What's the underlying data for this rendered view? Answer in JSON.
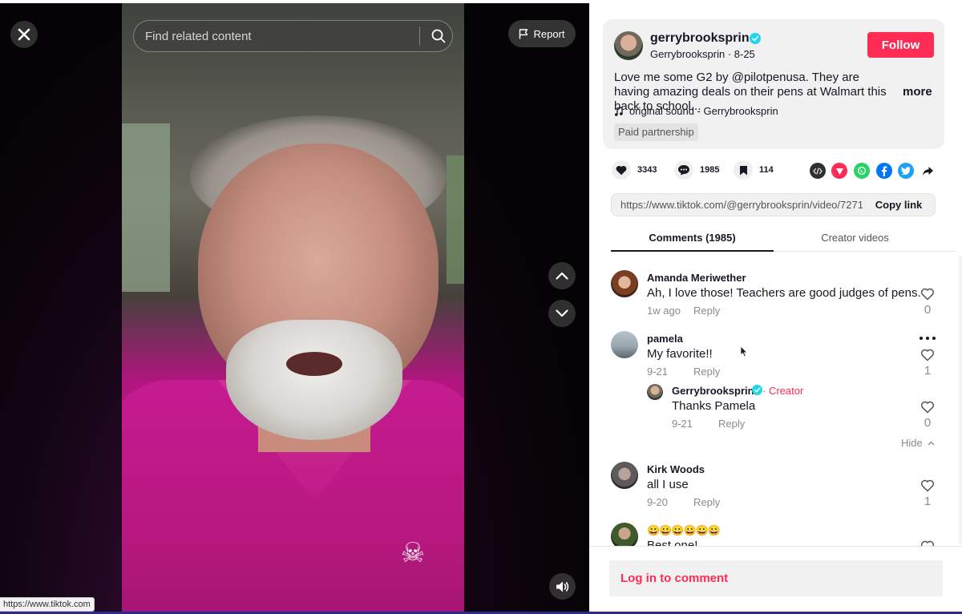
{
  "video": {
    "search_placeholder": "Find related content",
    "report_label": "Report",
    "status_url": "https://www.tiktok.com"
  },
  "author": {
    "username": "gerrybrooksprin",
    "nickname": "Gerrybrooksprin",
    "date": "8-25",
    "follow_label": "Follow",
    "caption": "Love me some G2 by @pilotpenusa. They are having amazing deals on their pens at Walmart this back to school...",
    "more_label": "more",
    "sound": "original sound - Gerrybrooksprin",
    "paid_label": "Paid partnership"
  },
  "stats": {
    "likes": "3343",
    "comments": "1985",
    "saves": "114"
  },
  "share": {
    "icons": [
      "embed-icon",
      "send-icon",
      "whatsapp-icon",
      "facebook-icon",
      "twitter-icon",
      "share-arrow-icon"
    ],
    "colors": {
      "embed": "#2f2f2f",
      "send": "#fe2c55",
      "whatsapp": "#25d366",
      "facebook": "#0075fa",
      "twitter": "#1da1f2"
    }
  },
  "link": {
    "url": "https://www.tiktok.com/@gerrybrooksprin/video/7271...",
    "copy_label": "Copy link"
  },
  "tabs": {
    "comments": "Comments (1985)",
    "creator": "Creator videos"
  },
  "comments": [
    {
      "user": "Amanda Meriwether",
      "text": "Ah, I love those! Teachers are good judges of pens.",
      "time": "1w ago",
      "reply": "Reply",
      "likes": "0"
    },
    {
      "user": "pamela",
      "text": "My favorite!!",
      "time": "9-21",
      "reply": "Reply",
      "likes": "1"
    },
    {
      "user": "Kirk Woods",
      "text": "all I use",
      "time": "9-20",
      "reply": "Reply",
      "likes": "1"
    },
    {
      "user": "😀😀😀😀😀😀",
      "text": "Best one!"
    }
  ],
  "creator_reply": {
    "user": "Gerrybrooksprin",
    "badge": "Creator",
    "text": "Thanks Pamela",
    "time": "9-21",
    "reply": "Reply",
    "likes": "0",
    "hide_label": "Hide"
  },
  "login": {
    "label": "Log in to comment"
  },
  "colors": {
    "brand": "#fe2c55",
    "verified": "#20d5ec",
    "text": "#161823",
    "muted": "#8a8b91"
  }
}
